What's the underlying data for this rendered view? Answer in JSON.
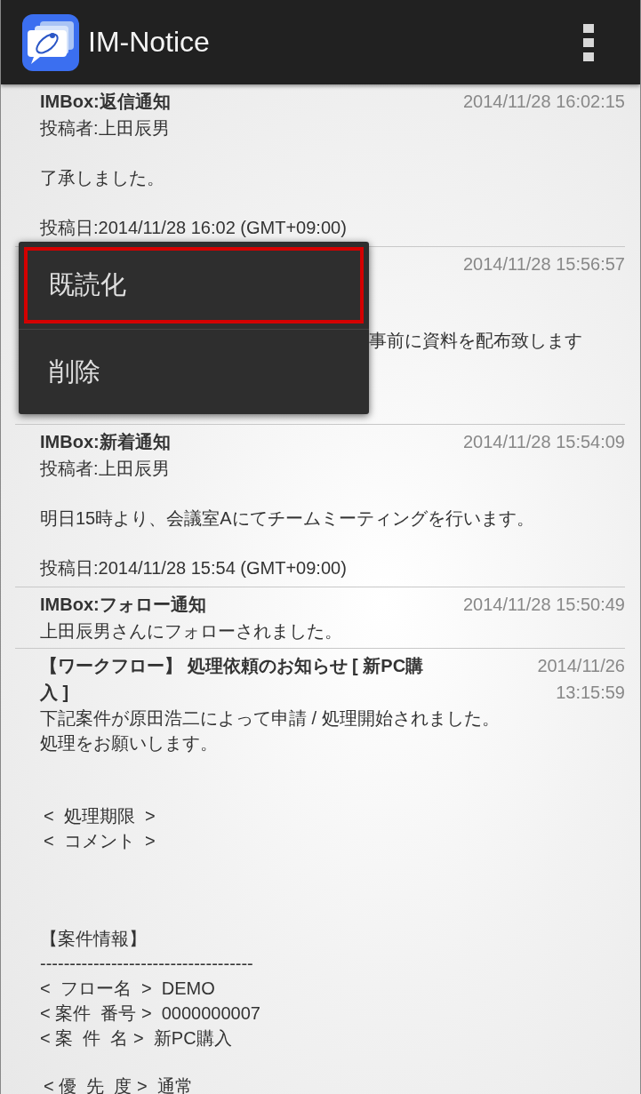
{
  "app_bar": {
    "title": "IM-Notice"
  },
  "notices": [
    {
      "kind": "post",
      "title": "IMBox:返信通知",
      "time": "2014/11/28 16:02:15",
      "author": "投稿者:上田辰男",
      "body": "了承しました。",
      "posted": "投稿日:2014/11/28 16:02 (GMT+09:00)"
    },
    {
      "kind": "covered",
      "time": "2014/11/28 15:56:57",
      "body": "事前に資料を配布致します"
    },
    {
      "kind": "post",
      "title": "IMBox:新着通知",
      "time": "2014/11/28 15:54:09",
      "author": "投稿者:上田辰男",
      "body": "明日15時より、会議室Aにてチームミーティングを行います。",
      "posted": "投稿日:2014/11/28 15:54 (GMT+09:00)"
    },
    {
      "kind": "simple",
      "title": "IMBox:フォロー通知",
      "time": "2014/11/28 15:50:49",
      "body": "上田辰男さんにフォローされました。"
    },
    {
      "kind": "workflow",
      "title": "【ワークフロー】 処理依頼のお知らせ [ 新PC購入 ]",
      "time": "2014/11/26 13:15:59",
      "blocks": [
        [
          "下記案件が原田浩二によって申請 / 処理開始されました。",
          "処理をお願いします。"
        ],
        [
          "<  処理期限  >",
          "<  コメント  >"
        ],
        [
          "【案件情報】",
          "------------------------------------",
          "<  フロー名  >  DEMO",
          "< 案件  番号 >  0000000007",
          "< 案  件  名 >  新PC購入"
        ],
        [
          "< 優  先  度 >  通常"
        ]
      ]
    }
  ],
  "menu": {
    "items": [
      {
        "label": "既読化",
        "selected": true
      },
      {
        "label": "削除",
        "selected": false
      }
    ]
  }
}
